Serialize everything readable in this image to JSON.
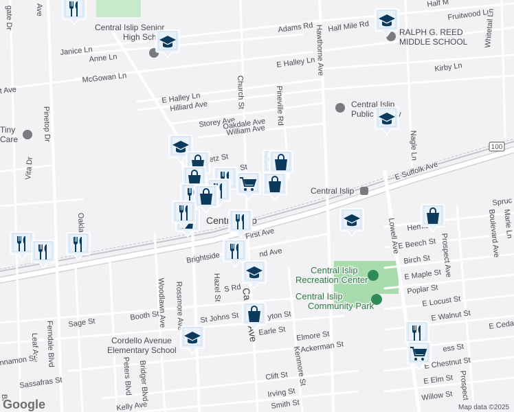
{
  "map": {
    "streets": [
      {
        "id": "adams",
        "text": "Adams Rd"
      },
      {
        "id": "halfmile",
        "text": "Half Mile Rd"
      },
      {
        "id": "halfm_top",
        "text": "Half M"
      },
      {
        "id": "fruitwood",
        "text": "Fruitwood Ln"
      },
      {
        "id": "janice",
        "text": "Janice Ln"
      },
      {
        "id": "anne",
        "text": "Anne Ln"
      },
      {
        "id": "mcgowan",
        "text": "McGowan Ln"
      },
      {
        "id": "ehalley",
        "text": "E Halley Ln"
      },
      {
        "id": "ehalley2",
        "text": "E Halley Ln"
      },
      {
        "id": "hilliard",
        "text": "Hilliard Ave"
      },
      {
        "id": "storey",
        "text": "Storey Ave"
      },
      {
        "id": "oakdale",
        "text": "Oakdale Ave"
      },
      {
        "id": "william",
        "text": "William Ave"
      },
      {
        "id": "church",
        "text": "Church St"
      },
      {
        "id": "pineville",
        "text": "Pineville Rd"
      },
      {
        "id": "hawthorne",
        "text": "Hawthorne Ave"
      },
      {
        "id": "kirby",
        "text": "Kirby Ln"
      },
      {
        "id": "whitetail",
        "text": "Whitetail Ln"
      },
      {
        "id": "nagle",
        "text": "Nagle Ln"
      },
      {
        "id": "esuffolk",
        "text": "E Suffolk Ave"
      },
      {
        "id": "pinetop",
        "text": "Pinetop Dr"
      },
      {
        "id": "vita",
        "text": "Vita Dr"
      },
      {
        "id": "oakland",
        "text": "Oakla"
      },
      {
        "id": "tave",
        "text": "t Ave"
      },
      {
        "id": "gatedr",
        "text": "gate Dr"
      },
      {
        "id": "ave_top",
        "text": "Ave"
      },
      {
        "id": "etz",
        "text": "etz St"
      },
      {
        "id": "st1",
        "text": "St"
      },
      {
        "id": "firstave",
        "text": "First Ave"
      },
      {
        "id": "brightside",
        "text": "Brightside"
      },
      {
        "id": "ndave",
        "text": "nd Ave"
      },
      {
        "id": "woodlawn",
        "text": "Woodlawn Ave"
      },
      {
        "id": "rossmore",
        "text": "Rossmore Ave"
      },
      {
        "id": "hazel",
        "text": "Hazel St"
      },
      {
        "id": "srd",
        "text": "S Rd"
      },
      {
        "id": "carleton",
        "text": "Ca"
      },
      {
        "id": "ave_car",
        "text": "Ave"
      },
      {
        "id": "booth",
        "text": "Booth St"
      },
      {
        "id": "stjohns",
        "text": "St Johns St"
      },
      {
        "id": "yton",
        "text": "yton St"
      },
      {
        "id": "earle",
        "text": "Earle St"
      },
      {
        "id": "elmore",
        "text": "Elmore St"
      },
      {
        "id": "ackerman",
        "text": "Ackerman St"
      },
      {
        "id": "kenmore",
        "text": "Kenmore St"
      },
      {
        "id": "clift",
        "text": "Clift St"
      },
      {
        "id": "irving",
        "text": "Irving St"
      },
      {
        "id": "smith",
        "text": "Smith St"
      },
      {
        "id": "sage",
        "text": "Sage St"
      },
      {
        "id": "ferndale",
        "text": "Ferndale Blvd"
      },
      {
        "id": "leaf",
        "text": "Leaf Ave"
      },
      {
        "id": "cinnamon",
        "text": "nnamon St"
      },
      {
        "id": "sassafras",
        "text": "Sassafras St"
      },
      {
        "id": "br",
        "text": "Br"
      },
      {
        "id": "peters",
        "text": "Peters Blvd"
      },
      {
        "id": "bridger",
        "text": "Bridger Blvd"
      },
      {
        "id": "kelly",
        "text": "Kelly Ave"
      },
      {
        "id": "lowell",
        "text": "Lowell Ave"
      },
      {
        "id": "hemlock",
        "text": "Hemlock St"
      },
      {
        "id": "ebeech",
        "text": "E Beech St"
      },
      {
        "id": "birch",
        "text": "Birch St"
      },
      {
        "id": "emaple",
        "text": "E Maple St"
      },
      {
        "id": "poplar",
        "text": "Poplar St"
      },
      {
        "id": "elocust",
        "text": "E Locust St"
      },
      {
        "id": "ewalnut",
        "text": "E Walnut St"
      },
      {
        "id": "ecedar",
        "text": "E Cedar"
      },
      {
        "id": "ess",
        "text": "ess St"
      },
      {
        "id": "echestnut",
        "text": "E Chestnut St"
      },
      {
        "id": "eelm",
        "text": "E Elm St"
      },
      {
        "id": "willow",
        "text": "Willow St"
      },
      {
        "id": "prospect",
        "text": "Prospect Ave"
      },
      {
        "id": "prospect2",
        "text": "Prospect"
      },
      {
        "id": "boulevard",
        "text": "Boulevard Ave"
      },
      {
        "id": "marie",
        "text": "Marie Ln"
      },
      {
        "id": "spruc",
        "text": "Spruc"
      }
    ],
    "places": [
      {
        "id": "ci_senior",
        "lines": [
          "Central Islip Senior",
          "High School"
        ]
      },
      {
        "id": "reed",
        "lines": [
          "RALPH G. REED",
          "MIDDLE SCHOOL"
        ]
      },
      {
        "id": "library",
        "lines": [
          "Central Islip",
          "Public Library"
        ]
      },
      {
        "id": "tiny",
        "lines": [
          "Tiny",
          "Care"
        ]
      },
      {
        "id": "station",
        "lines": [
          "Central Islip"
        ]
      },
      {
        "id": "town",
        "lines": [
          "Central Islip"
        ]
      },
      {
        "id": "rec",
        "lines": [
          "Central Islip",
          "Recreation Center"
        ]
      },
      {
        "id": "park",
        "lines": [
          "Central Islip",
          "Community Park"
        ]
      },
      {
        "id": "cordello",
        "lines": [
          "Cordello Avenue",
          "Elementary School"
        ]
      }
    ],
    "shield": "100",
    "markers": [
      {
        "type": "restaurant"
      },
      {
        "type": "school"
      },
      {
        "type": "school"
      },
      {
        "type": "school"
      },
      {
        "type": "school"
      },
      {
        "type": "school"
      },
      {
        "type": "school"
      },
      {
        "type": "school"
      },
      {
        "type": "restaurant"
      },
      {
        "type": "restaurant"
      },
      {
        "type": "restaurant"
      },
      {
        "type": "shopping"
      },
      {
        "type": "shopping"
      },
      {
        "type": "shopping"
      },
      {
        "type": "shopping"
      },
      {
        "type": "shopping"
      },
      {
        "type": "restaurant"
      },
      {
        "type": "restaurant"
      },
      {
        "type": "restaurant"
      },
      {
        "type": "grocery"
      },
      {
        "type": "shopping"
      },
      {
        "type": "shopping"
      },
      {
        "type": "shopping"
      },
      {
        "type": "restaurant"
      },
      {
        "type": "restaurant"
      },
      {
        "type": "shopping"
      },
      {
        "type": "shopping"
      },
      {
        "type": "restaurant"
      },
      {
        "type": "grocery"
      },
      {
        "type": "shopping"
      }
    ]
  },
  "attribution": {
    "logo": "Google",
    "data": "Map data ©2025"
  },
  "colors": {
    "marker_fill": "#e9f1fb",
    "marker_stroke": "#0a3d62",
    "marker_icon": "#0b3a5c",
    "park": "#9fd8a6",
    "road": "#ffffff",
    "rail": "#b8b8be"
  }
}
